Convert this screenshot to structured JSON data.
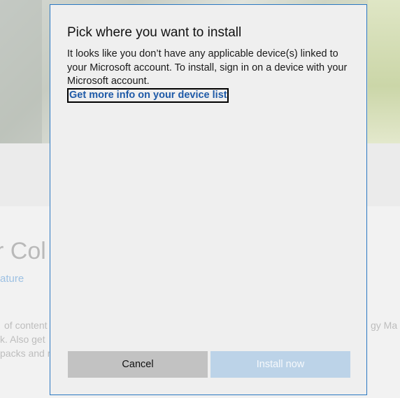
{
  "background": {
    "title_fragment": "r Col",
    "link_fragment": "ature",
    "desc_fragments": [
      "of content",
      "k. Also get",
      "packs and r",
      "gy Ma"
    ]
  },
  "dialog": {
    "title": "Pick where you want to install",
    "body": "It looks like you don’t have any applicable device(s) linked to your Microsoft account. To install, sign in on a device with your Microsoft account.",
    "link": "Get more info on your device list",
    "cancel_label": "Cancel",
    "install_label": "Install now",
    "colors": {
      "accent_border": "#2b78c2",
      "link": "#1e5aa8",
      "install_disabled_bg": "#bcd3e8",
      "cancel_bg": "#c2c2c2"
    }
  }
}
